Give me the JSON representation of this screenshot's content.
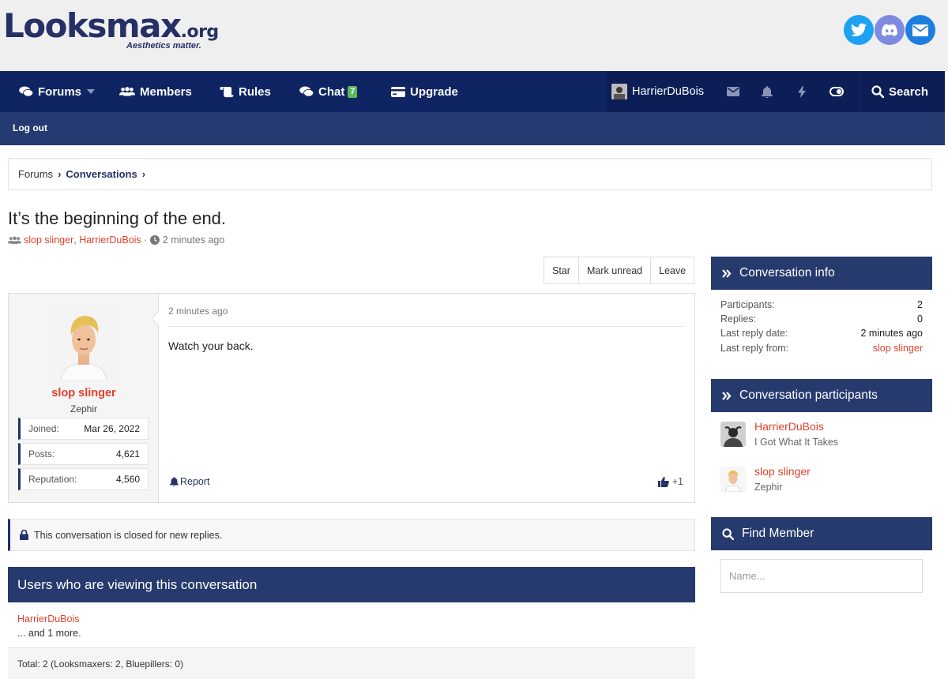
{
  "brand": {
    "logo_main": "Looksmax",
    "logo_org": ".org",
    "tagline": "Aesthetics matter."
  },
  "nav": {
    "forums": "Forums",
    "members": "Members",
    "rules": "Rules",
    "chat": "Chat",
    "chat_badge": "7",
    "upgrade": "Upgrade",
    "username": "HarrierDuBois",
    "search": "Search"
  },
  "subnav": {
    "logout": "Log out"
  },
  "breadcrumb": {
    "item1": "Forums",
    "item2": "Conversations"
  },
  "conversation": {
    "title": "It’s the beginning of the end.",
    "participant1": "slop slinger",
    "participant2": "HarrierDuBois",
    "time": "2 minutes ago"
  },
  "actions": {
    "star": "Star",
    "mark_unread": "Mark unread",
    "leave": "Leave"
  },
  "message": {
    "author": "slop slinger",
    "user_title": "Zephir",
    "stats": {
      "joined_label": "Joined:",
      "joined_value": "Mar 26, 2022",
      "posts_label": "Posts:",
      "posts_value": "4,621",
      "rep_label": "Reputation:",
      "rep_value": "4,560"
    },
    "date": "2 minutes ago",
    "text": "Watch your back.",
    "report": "Report",
    "likes": "+1"
  },
  "closed_notice": "This conversation is closed for new replies.",
  "viewers": {
    "title": "Users who are viewing this conversation",
    "user": "HarrierDuBois",
    "more": "... and 1 more.",
    "total": "Total: 2 (Looksmaxers: 2, Bluepillers: 0)"
  },
  "sidebar": {
    "info": {
      "title": "Conversation info",
      "participants_label": "Participants:",
      "participants_value": "2",
      "replies_label": "Replies:",
      "replies_value": "0",
      "last_date_label": "Last reply date:",
      "last_date_value": "2 minutes ago",
      "last_from_label": "Last reply from:",
      "last_from_value": "slop slinger"
    },
    "participants": {
      "title": "Conversation participants",
      "p1_name": "HarrierDuBois",
      "p1_title": "I Got What It Takes",
      "p2_name": "slop slinger",
      "p2_title": "Zephir"
    },
    "find": {
      "title": "Find Member",
      "placeholder": "Name..."
    }
  },
  "colors": {
    "nav": "#0f2463",
    "subnav": "#253a70",
    "accent": "#e0412c",
    "panel": "#263a6e"
  }
}
